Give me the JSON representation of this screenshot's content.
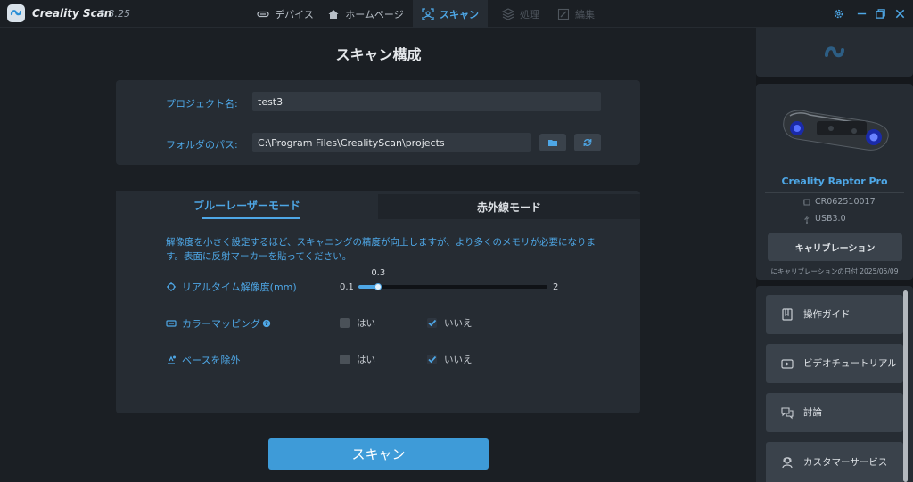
{
  "app": {
    "title": "Creality Scan",
    "version": "3.3.25"
  },
  "tabs": [
    {
      "label": "デバイス",
      "icon": "device-link-icon",
      "state": "normal"
    },
    {
      "label": "ホームページ",
      "icon": "home-icon",
      "state": "normal"
    },
    {
      "label": "スキャン",
      "icon": "scan-frame-icon",
      "state": "active"
    },
    {
      "label": "処理",
      "icon": "process-icon",
      "state": "disabled"
    },
    {
      "label": "編集",
      "icon": "edit-icon",
      "state": "disabled"
    }
  ],
  "window_controls": [
    "settings-gear-icon",
    "minimize-icon",
    "restore-icon",
    "close-icon"
  ],
  "main": {
    "section_title": "スキャン構成",
    "project": {
      "name_label": "プロジェクト名:",
      "name_value": "test3",
      "folder_label": "フォルダのパス:",
      "folder_value": "C:\\Program Files\\CrealityScan\\projects"
    },
    "mode_tabs": {
      "blue_laser": "ブルーレーザーモード",
      "infrared": "赤外線モード"
    },
    "description": "解像度を小さく設定するほど、スキャニングの精度が向上しますが、より多くのメモリが必要になります。表面に反射マーカーを貼ってください。",
    "options": {
      "resolution": {
        "label": "リアルタイム解像度(mm)",
        "min": "0.1",
        "max": "2",
        "value": "0.3",
        "value_num": 0.3,
        "min_num": 0.1,
        "max_num": 2
      },
      "color_mapping": {
        "label": "カラーマッピング",
        "yes": "はい",
        "no": "いいえ",
        "selected": "no"
      },
      "remove_base": {
        "label": "ベースを除外",
        "yes": "はい",
        "no": "いいえ",
        "selected": "no"
      }
    },
    "scan_button": "スキャン"
  },
  "sidebar": {
    "device": {
      "name": "Creality Raptor Pro",
      "serial": "CR062510017",
      "connection": "USB3.0",
      "calibrate_button": "キャリブレーション",
      "calibration_date": "にキャリブレーションの日付 2025/05/09"
    },
    "links": [
      {
        "label": "操作ガイド",
        "icon": "guide-book-icon"
      },
      {
        "label": "ビデオチュートリアル",
        "icon": "video-icon"
      },
      {
        "label": "討論",
        "icon": "chat-bubbles-icon"
      },
      {
        "label": "カスタマーサービス",
        "icon": "headset-icon"
      }
    ]
  },
  "colors": {
    "accent": "#4ea7e6",
    "background": "#1b1f24",
    "panel": "#262c33",
    "button": "#3e9bd8"
  }
}
